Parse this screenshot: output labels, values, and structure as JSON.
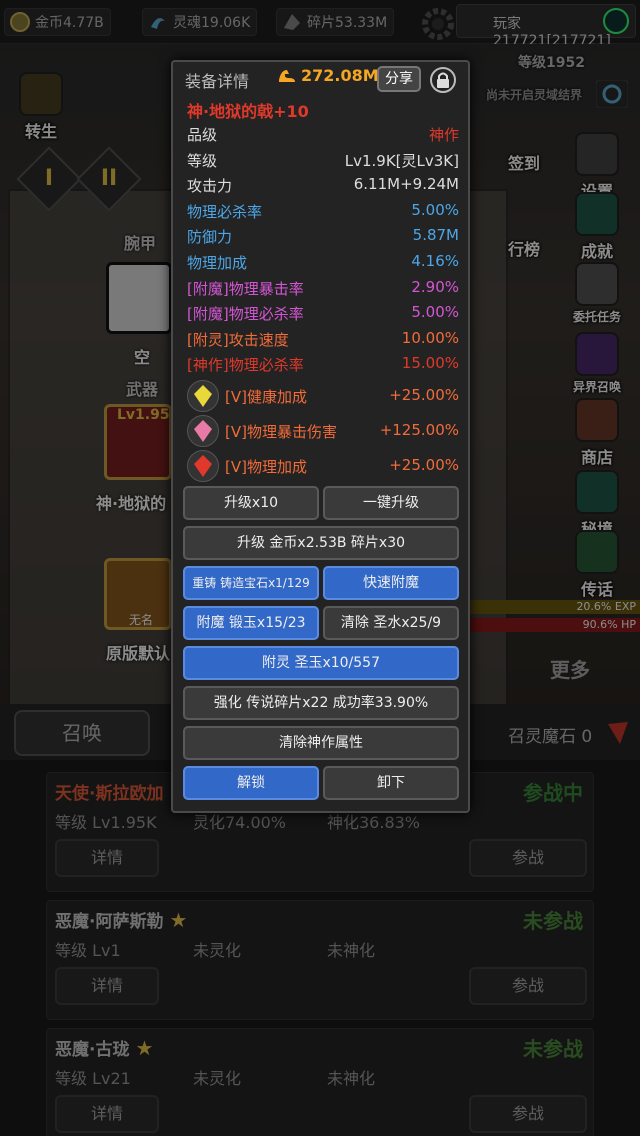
{
  "topbar": {
    "gold": "金币4.77B",
    "soul": "灵魂19.06K",
    "shards": "碎片53.33M",
    "player": "玩家217721[217721]"
  },
  "background": {
    "level": "等级1952",
    "hint": "尚未开启灵域结界",
    "side_left_rebirth": "转生",
    "tab_i": "I",
    "tab_ii": "II",
    "slot_wrist": "腕甲",
    "slot_empty": "空",
    "slot_weapon": "武器",
    "weapon_level": "Lv1.95",
    "weapon_name": "神·地狱的",
    "hero_tag": "无名",
    "skin_name": "原版默认",
    "right_menu": [
      "设置",
      "签到",
      "行榜",
      "成就",
      "委托任务",
      "异界召唤",
      "商店",
      "秘境",
      "传话"
    ],
    "exp_bar": "20.6% EXP",
    "hp_bar": "90.6% HP",
    "more": "更多"
  },
  "summon": {
    "summon_label": "召唤",
    "stone_label": "召灵魔石 0"
  },
  "heroes": [
    {
      "name": "天使·斯拉欧加",
      "state": "参战中",
      "level": "等级 Lv1.95K",
      "soul": "灵化74.00%",
      "god": "神化36.83%",
      "detail": "详情",
      "fight": "参战"
    },
    {
      "name": "恶魔·阿萨斯勒",
      "state": "未参战",
      "level": "等级 Lv1",
      "soul": "未灵化",
      "god": "未神化",
      "detail": "详情",
      "fight": "参战"
    },
    {
      "name": "恶魔·古珑",
      "state": "未参战",
      "level": "等级 Lv21",
      "soul": "未灵化",
      "god": "未神化",
      "detail": "详情",
      "fight": "参战"
    }
  ],
  "dialog": {
    "title": "装备详情",
    "power": "272.08M",
    "share": "分享",
    "item_name": "神·地狱的戟+10",
    "stats": [
      {
        "k": "品级",
        "v": "神作",
        "kc": "#dddddd",
        "vc": "#e0392b"
      },
      {
        "k": "等级",
        "v": "Lv1.9K[灵Lv3K]",
        "kc": "#dddddd",
        "vc": "#dddddd"
      },
      {
        "k": "攻击力",
        "v": "6.11M+9.24M",
        "kc": "#dddddd",
        "vc": "#dddddd"
      },
      {
        "k": "物理必杀率",
        "v": "5.00%",
        "kc": "#4da6e8",
        "vc": "#4da6e8"
      },
      {
        "k": "防御力",
        "v": "5.87M",
        "kc": "#4da6e8",
        "vc": "#4da6e8"
      },
      {
        "k": "物理加成",
        "v": "4.16%",
        "kc": "#4da6e8",
        "vc": "#4da6e8"
      },
      {
        "k": "[附魔]物理暴击率",
        "v": "2.90%",
        "kc": "#d456d4",
        "vc": "#d456d4"
      },
      {
        "k": "[附魔]物理必杀率",
        "v": "5.00%",
        "kc": "#d456d4",
        "vc": "#d456d4"
      },
      {
        "k": "[附灵]攻击速度",
        "v": "10.00%",
        "kc": "#f26b3a",
        "vc": "#f26b3a"
      },
      {
        "k": "[神作]物理必杀率",
        "v": "15.00%",
        "kc": "#e0392b",
        "vc": "#e0392b"
      }
    ],
    "gems": [
      {
        "k": "[V]健康加成",
        "v": "+25.00%",
        "icon": "yellow-gem-icon",
        "color": "#e8d83a"
      },
      {
        "k": "[V]物理暴击伤害",
        "v": "+125.00%",
        "icon": "pink-gem-icon",
        "color": "#e87aa8"
      },
      {
        "k": "[V]物理加成",
        "v": "+25.00%",
        "icon": "red-gem-icon",
        "color": "#e0392b"
      }
    ],
    "buttons": {
      "upgrade10": "升级x10",
      "upgrade_all": "一键升级",
      "upgrade_cost": "升级 金币x2.53B 碎片x30",
      "reforge": "重铸 铸造宝石x1/129",
      "quick_enchant": "快速附魔",
      "enchant": "附魔 锻玉x15/23",
      "clear_holy": "清除 圣水x25/9",
      "spirit": "附灵 圣玉x10/557",
      "strengthen": "强化 传说碎片x22 成功率33.90%",
      "clear_divine": "清除神作属性",
      "unlock": "解锁",
      "unequip": "卸下"
    }
  }
}
